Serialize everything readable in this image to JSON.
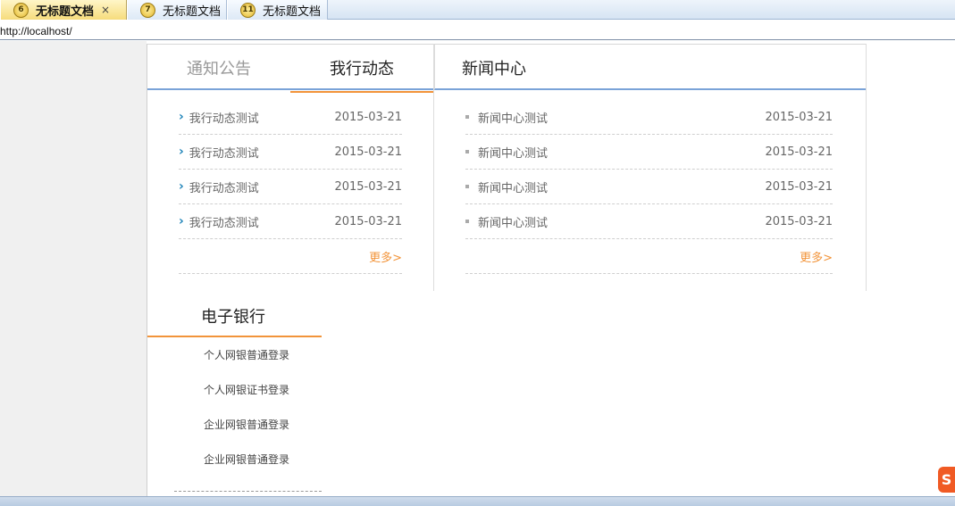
{
  "browser": {
    "tabs": [
      {
        "number": "6",
        "label": "无标题文档",
        "active": true,
        "close": "×"
      },
      {
        "number": "7",
        "label": "无标题文档",
        "active": false
      },
      {
        "number": "11",
        "label": "无标题文档",
        "active": false
      }
    ],
    "url": "http://localhost/"
  },
  "news_left": {
    "tab_inactive": "通知公告",
    "tab_active": "我行动态",
    "items": [
      {
        "title": "我行动态测试",
        "date": "2015-03-21"
      },
      {
        "title": "我行动态测试",
        "date": "2015-03-21"
      },
      {
        "title": "我行动态测试",
        "date": "2015-03-21"
      },
      {
        "title": "我行动态测试",
        "date": "2015-03-21"
      }
    ],
    "more": "更多>"
  },
  "news_right": {
    "title": "新闻中心",
    "items": [
      {
        "title": "新闻中心测试",
        "date": "2015-03-21"
      },
      {
        "title": "新闻中心测试",
        "date": "2015-03-21"
      },
      {
        "title": "新闻中心测试",
        "date": "2015-03-21"
      },
      {
        "title": "新闻中心测试",
        "date": "2015-03-21"
      }
    ],
    "more": "更多>"
  },
  "ebank": {
    "title": "电子银行",
    "items": [
      "个人网银普通登录",
      "个人网银证书登录",
      "企业网银普通登录",
      "企业网银普通登录"
    ]
  },
  "sogou_icon": "S",
  "colors": {
    "accent_orange": "#f2943a",
    "accent_blue": "#7aa3d8",
    "arrow_blue": "#1f84b9"
  }
}
